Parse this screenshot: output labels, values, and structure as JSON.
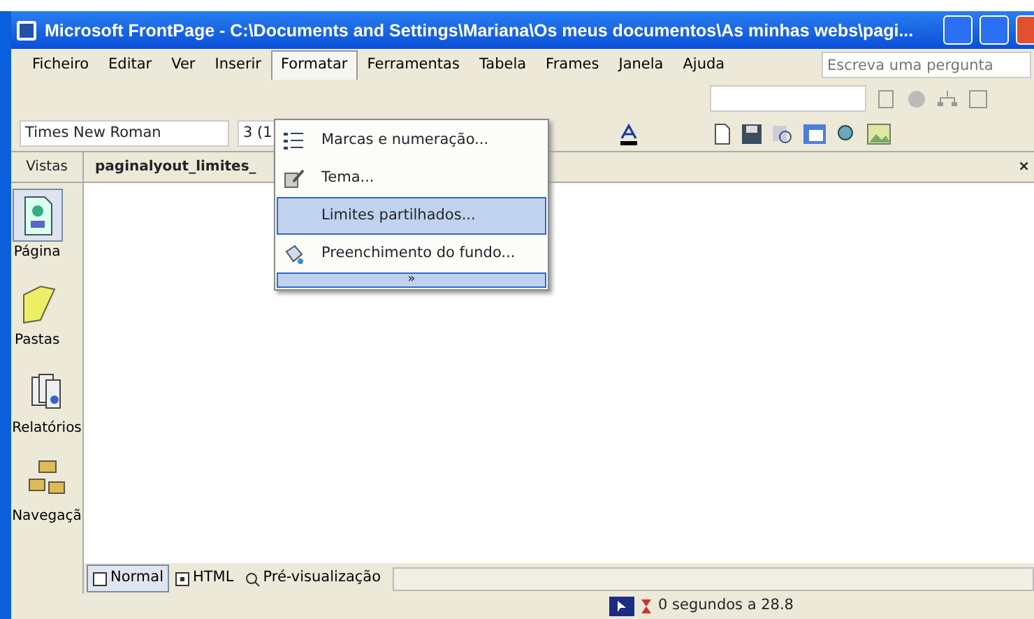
{
  "window": {
    "title": "Microsoft FrontPage - C:\\Documents and Settings\\Mariana\\Os meus documentos\\As minhas webs\\pagi..."
  },
  "menu_bar": [
    {
      "label": "Ficheiro",
      "selected": false
    },
    {
      "label": "Editar",
      "selected": false
    },
    {
      "label": "Ver",
      "selected": false
    },
    {
      "label": "Inserir",
      "selected": false
    },
    {
      "label": "Formatar",
      "selected": true
    },
    {
      "label": "Ferramentas",
      "selected": false
    },
    {
      "label": "Tabela",
      "selected": false
    },
    {
      "label": "Frames",
      "selected": false
    },
    {
      "label": "Janela",
      "selected": false
    },
    {
      "label": "Ajuda",
      "selected": false
    }
  ],
  "help_search": {
    "placeholder": "Escreva uma pergunta"
  },
  "format_toolbar": {
    "font": "Times New Roman",
    "size": "3 (1"
  },
  "format_menu": [
    {
      "label": "Marcas e numeração...",
      "selected": false,
      "kind": "item"
    },
    {
      "label": "Tema...",
      "selected": false,
      "kind": "item"
    },
    {
      "label": "Limites partilhados...",
      "selected": true,
      "kind": "item"
    },
    {
      "label": "Preenchimento do fundo...",
      "selected": false,
      "kind": "item"
    },
    {
      "label": "»",
      "kind": "expand"
    }
  ],
  "views_bar": {
    "title": "Vistas",
    "items": [
      {
        "label": "Página",
        "selected": true
      },
      {
        "label": "Pastas",
        "selected": false
      },
      {
        "label": "Relatórios",
        "selected": false
      },
      {
        "label": "Navegaçã",
        "selected": false
      }
    ]
  },
  "document_tab": {
    "label": "paginalyout_limites_",
    "close": "×"
  },
  "view_tabs": [
    {
      "label": "Normal",
      "selected": true
    },
    {
      "label": "HTML",
      "selected": false
    },
    {
      "label": "Pré-visualização",
      "selected": false
    }
  ],
  "status_bar": {
    "text": "0 segundos a 28.8"
  }
}
